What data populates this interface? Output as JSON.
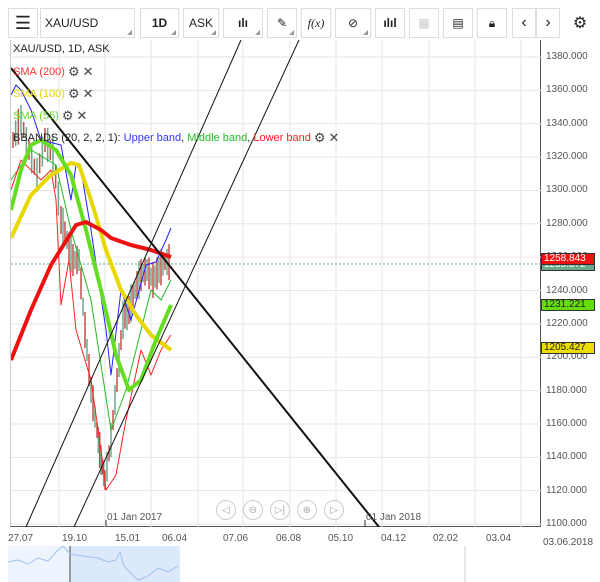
{
  "toolbar": {
    "symbol": "XAU/USD",
    "period": "1D",
    "side": "ASK"
  },
  "chart": {
    "title": "XAU/USD, 1D, ASK",
    "indicators": [
      {
        "label": "SMA (200)",
        "color": "#ff3333"
      },
      {
        "label": "SMA (100)",
        "color": "#e8d800"
      },
      {
        "label": "SMA (55)",
        "color": "#66dd22"
      }
    ],
    "bbands": {
      "prefix": "BBANDS (20, 2, 2, 1): ",
      "upper": "Upper band",
      "middle": "Middle band",
      "lower": "Lower band",
      "sep": ", "
    },
    "y_ticks": [
      "1380.000",
      "1360.000",
      "1340.000",
      "1320.000",
      "1300.000",
      "1280.000",
      "1260.000",
      "1240.000",
      "1220.000",
      "1200.000",
      "1180.000",
      "1160.000",
      "1140.000",
      "1120.000",
      "1100.000"
    ],
    "x_ticks": [
      "27.07",
      "19.10",
      "15.01",
      "06.04",
      "07.06",
      "06.08",
      "05.10",
      "04.12",
      "02.02",
      "03.04"
    ],
    "x_end": "03.06.2018",
    "year_marks": [
      "01 Jan 2017",
      "01 Jan 2018"
    ],
    "price_tags": [
      {
        "value": "1258.843",
        "bg": "#ee1111",
        "fg": "#fff"
      },
      {
        "value": "1255.372",
        "bg": "#6aa88a",
        "fg": "#fff"
      },
      {
        "value": "1231.221",
        "bg": "#66dd11",
        "fg": "#222"
      },
      {
        "value": "1205.427",
        "bg": "#eedd00",
        "fg": "#222"
      }
    ]
  }
}
